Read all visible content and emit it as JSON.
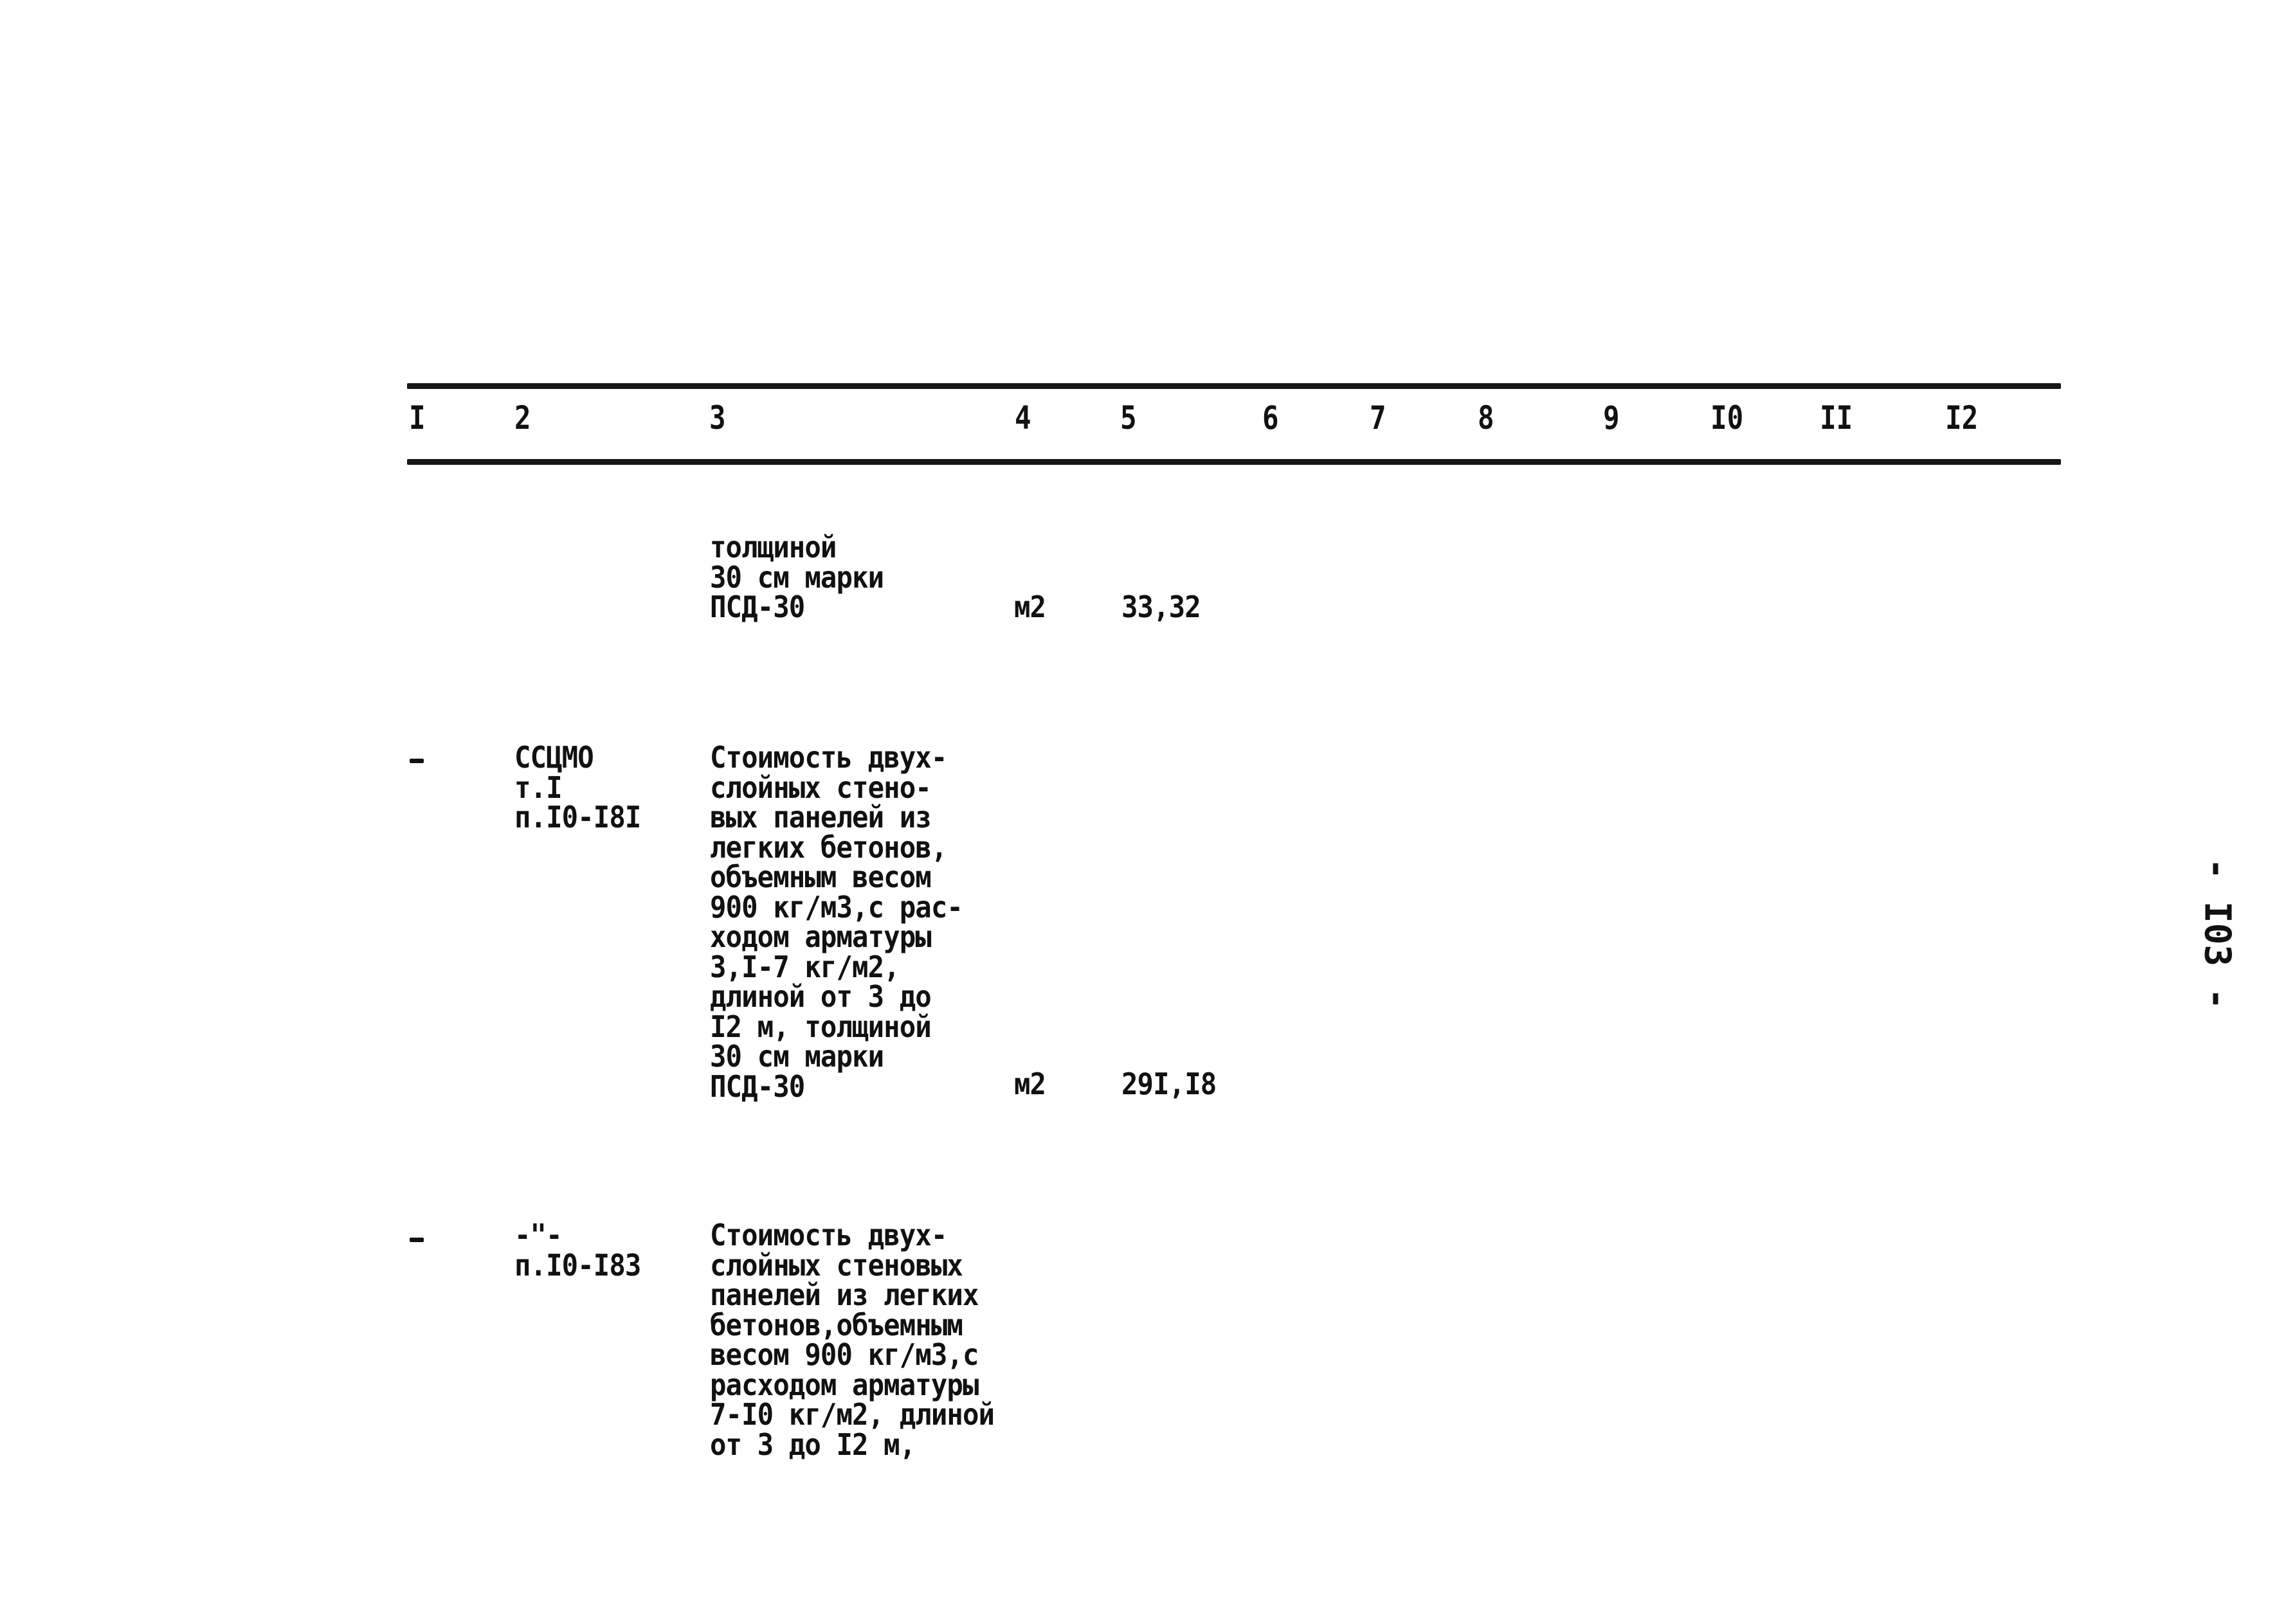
{
  "page": {
    "page_number": "- I03 -"
  },
  "table": {
    "column_numbers": [
      "I",
      "2",
      "3",
      "4",
      "5",
      "6",
      "7",
      "8",
      "9",
      "I0",
      "II",
      "I2"
    ],
    "rows": [
      {
        "col1": "",
        "col2": "",
        "description": "толщиной\n30 см марки\nПСД-30",
        "unit": "м2",
        "value": "33,32"
      },
      {
        "col1": "-",
        "col2": "ССЦМО\nт.I\nп.I0-I8I",
        "description": "Стоимость двух-\nслойных стено-\nвых панелей из\nлегких бетонов,\nобъемным весом\n900 кг/м3,с рас-\nходом арматуры\n3,I-7 кг/м2,\nдлиной от 3 до\nI2 м, толщиной\n30 см марки\nПСД-30",
        "unit": "м2",
        "value": "29I,I8"
      },
      {
        "col1": "-",
        "col2": "-\"-\nп.I0-I83",
        "description": "Стоимость двух-\nслойных стеновых\nпанелей из легких\nбетонов,объемным\nвесом 900 кг/м3,с\nрасходом арматуры\n7-I0 кг/м2, длиной\nот 3 до I2 м,",
        "unit": "",
        "value": ""
      }
    ]
  }
}
